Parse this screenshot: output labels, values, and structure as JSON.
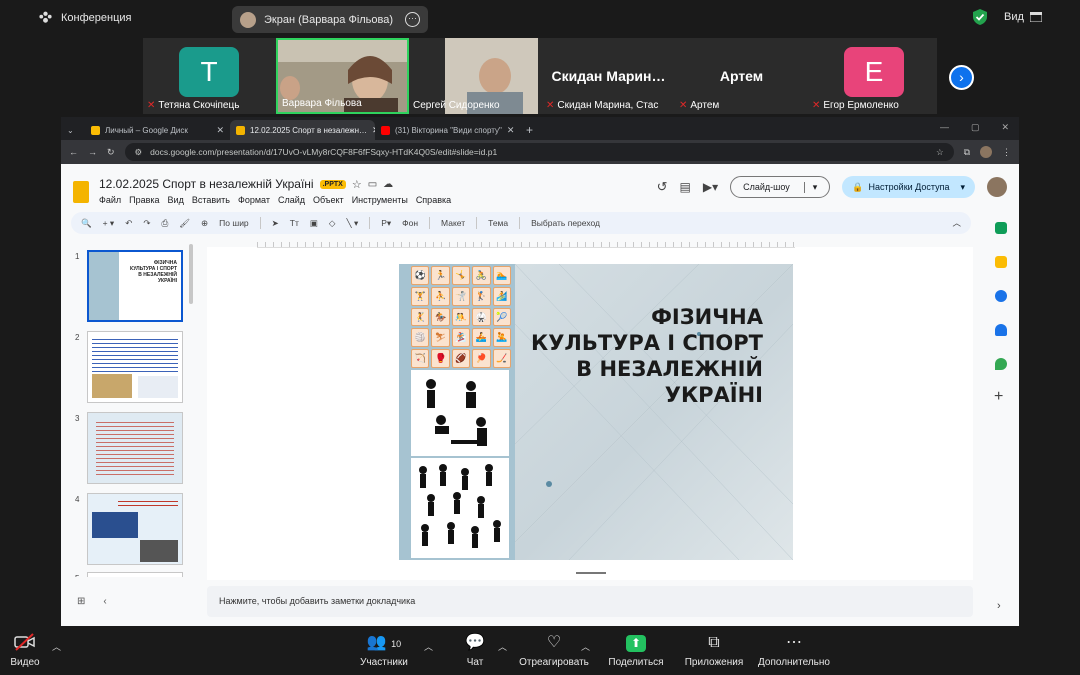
{
  "zoom": {
    "meeting_label": "Конференция",
    "share_label": "Экран (Варвара Фільова)",
    "view_label": "Вид",
    "participants": [
      {
        "name": "Тетяна Скочіпець",
        "initial": "T",
        "color": "#1a9b8c",
        "muted": true
      },
      {
        "name": "Варвара Фільова",
        "muted": false,
        "video": true
      },
      {
        "name": "Сергей Сидоренко",
        "muted": false,
        "video": true
      },
      {
        "name": "Скидан Марина, Стас",
        "big": "Скидан Марин…",
        "muted": true
      },
      {
        "name": "Артем",
        "big": "Артем",
        "muted": true
      },
      {
        "name": "Егор Ермоленко",
        "initial": "E",
        "color": "#e8447a",
        "muted": true
      }
    ],
    "toolbar": {
      "video": "Видео",
      "participants": "Участники",
      "participants_count": "10",
      "chat": "Чат",
      "react": "Отреагировать",
      "share": "Поделиться",
      "apps": "Приложения",
      "more": "Дополнительно"
    }
  },
  "browser": {
    "tabs": [
      {
        "title": "Личный – Google Диск",
        "color": "#fbbc04"
      },
      {
        "title": "12.02.2025 Спорт в незалежн…",
        "color": "#f4b400",
        "active": true
      },
      {
        "title": "(31) Вікторина \"Види спорту\"",
        "color": "#ff0000"
      }
    ],
    "url": "docs.google.com/presentation/d/17UvO-vLMy8rCQF8F6fFSqxy-HTdK4Q0S/edit#slide=id.p1"
  },
  "slides_app": {
    "title": "12.02.2025  Спорт в незалежній Україні",
    "badge": ".PPTX",
    "menus": [
      "Файл",
      "Правка",
      "Вид",
      "Вставить",
      "Формат",
      "Слайд",
      "Объект",
      "Инструменты",
      "Справка"
    ],
    "slideshow": "Слайд-шоу",
    "access": "Настройки Доступа",
    "toolbar": {
      "zoom": "По шир",
      "background": "Фон",
      "layout": "Макет",
      "theme": "Тема",
      "transition": "Выбрать переход"
    },
    "thumbnails": [
      "1",
      "2",
      "3",
      "4",
      "5"
    ],
    "slide_title_lines": [
      "ФІЗИЧНА",
      "КУЛЬТУРА І СПОРТ",
      "В НЕЗАЛЕЖНІЙ",
      "УКРАЇНІ"
    ],
    "notes_placeholder": "Нажмите, чтобы добавить заметки докладчика"
  }
}
